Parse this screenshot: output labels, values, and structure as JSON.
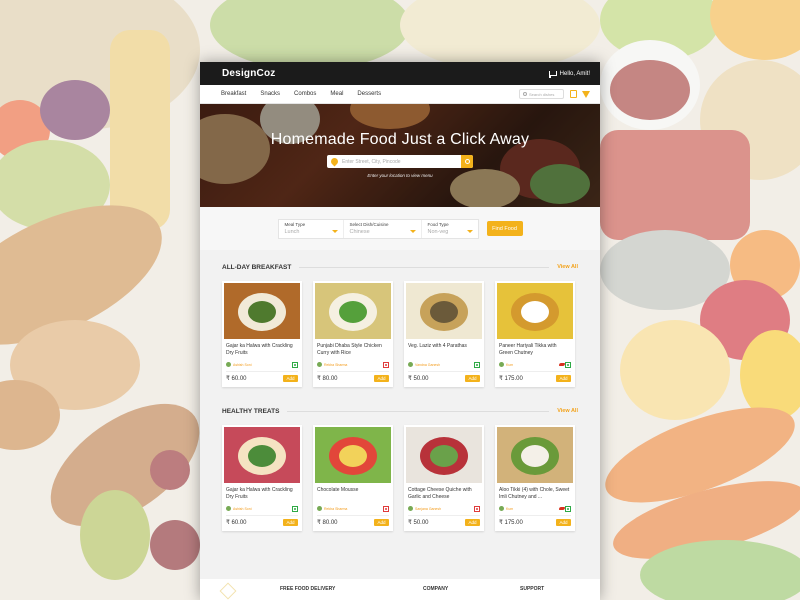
{
  "brand": {
    "logo": "DesignCoz"
  },
  "header": {
    "greeting": "Hello, Amit!"
  },
  "nav": {
    "items": [
      "Breakfast",
      "Snacks",
      "Combos",
      "Meal",
      "Desserts"
    ],
    "search_placeholder": "Search dishes"
  },
  "hero": {
    "title": "Homemade Food Just a Click Away",
    "search_placeholder": "Enter Street, City, Pincode",
    "hint": "Enter your location to view menu"
  },
  "filters": {
    "meal_type_label": "Meal Type",
    "meal_type_value": "Lunch",
    "dish_label": "Select Dish/Cuisine",
    "dish_value": "Chinese",
    "food_type_label": "Food Type",
    "food_type_value": "Non-veg",
    "find_button": "Find Food"
  },
  "sections": [
    {
      "title": "ALL-DAY BREAKFAST",
      "view_all": "View All",
      "cards": [
        {
          "name": "Gajar ka Halwa with Crackling Dry Fruits",
          "chef": "Ashish Soni",
          "price": "₹ 60.00",
          "add": "Add",
          "veg": true,
          "spicy": false
        },
        {
          "name": "Punjabi Dhaba Style Chicken Curry with Rice",
          "chef": "Rekha Sharma",
          "price": "₹ 80.00",
          "add": "Add",
          "veg": false,
          "spicy": false
        },
        {
          "name": "Veg. Laziz with 4 Parathas",
          "chef": "Vandna Ganesh",
          "price": "₹ 50.00",
          "add": "Add",
          "veg": true,
          "spicy": false
        },
        {
          "name": "Paneer Hariyali Tikka with Green Chutney",
          "chef": "Kum",
          "price": "₹ 175.00",
          "add": "Add",
          "veg": true,
          "spicy": true
        }
      ]
    },
    {
      "title": "HEALTHY TREATS",
      "view_all": "View All",
      "cards": [
        {
          "name": "Gajar ka Halwa with Crackling Dry Fruits",
          "chef": "Ashish Soni",
          "price": "₹ 60.00",
          "add": "Add",
          "veg": true,
          "spicy": false
        },
        {
          "name": "Chocolate Mousse",
          "chef": "Rekha Sharma",
          "price": "₹ 80.00",
          "add": "Add",
          "veg": false,
          "spicy": false
        },
        {
          "name": "Cottage Cheese Quiche with Garlic and Cheese",
          "chef": "Sanjana Ganesh",
          "price": "₹ 50.00",
          "add": "Add",
          "veg": false,
          "spicy": false
        },
        {
          "name": "Aloo Tikki (4) with Chole, Sweet Imli Chutney and ...",
          "chef": "Kum",
          "price": "₹ 175.00",
          "add": "Add",
          "veg": true,
          "spicy": true
        }
      ]
    }
  ],
  "footer": {
    "col1": "FREE FOOD DELIVERY",
    "col2": "COMPANY",
    "col3": "SUPPORT"
  },
  "colors": {
    "accent": "#f3b21b",
    "veg": "#2eaa45",
    "nonveg": "#e03a3a",
    "dark": "#1b1b1b"
  }
}
